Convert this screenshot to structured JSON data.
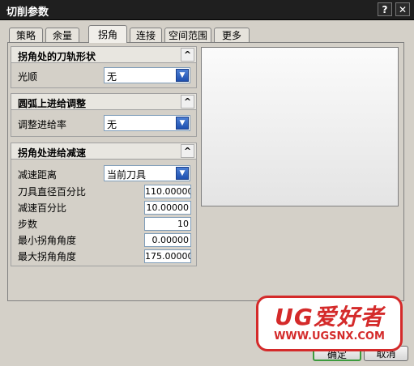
{
  "window": {
    "title": "切削参数",
    "help_glyph": "?",
    "close_glyph": "✕"
  },
  "tabs": [
    {
      "label": "策略",
      "active": false
    },
    {
      "label": "余量",
      "active": false
    },
    {
      "label": "拐角",
      "active": true
    },
    {
      "label": "连接",
      "active": false
    },
    {
      "label": "空间范围",
      "active": false
    },
    {
      "label": "更多",
      "active": false
    }
  ],
  "sections": {
    "corner_shape": {
      "title": "拐角处的刀轨形状",
      "smooth_label": "光顺",
      "smooth_value": "无"
    },
    "arc_feed": {
      "title": "圆弧上进给调整",
      "adjust_label": "调整进给率",
      "adjust_value": "无"
    },
    "corner_slowdown": {
      "title": "拐角处进给减速",
      "distance_label": "减速距离",
      "distance_value": "当前刀具",
      "tool_dia_pct_label": "刀具直径百分比",
      "tool_dia_pct_value": "110.00000",
      "slow_pct_label": "减速百分比",
      "slow_pct_value": "10.00000",
      "steps_label": "步数",
      "steps_value": "10",
      "min_angle_label": "最小拐角角度",
      "min_angle_value": "0.00000",
      "max_angle_label": "最大拐角角度",
      "max_angle_value": "175.00000"
    }
  },
  "buttons": {
    "ok": "确定",
    "cancel": "取消"
  },
  "icons": {
    "collapse": "^",
    "dropdown": "▼"
  },
  "watermark": {
    "line1": "UG爱好者",
    "line2": "WWW.UGSNX.COM"
  }
}
